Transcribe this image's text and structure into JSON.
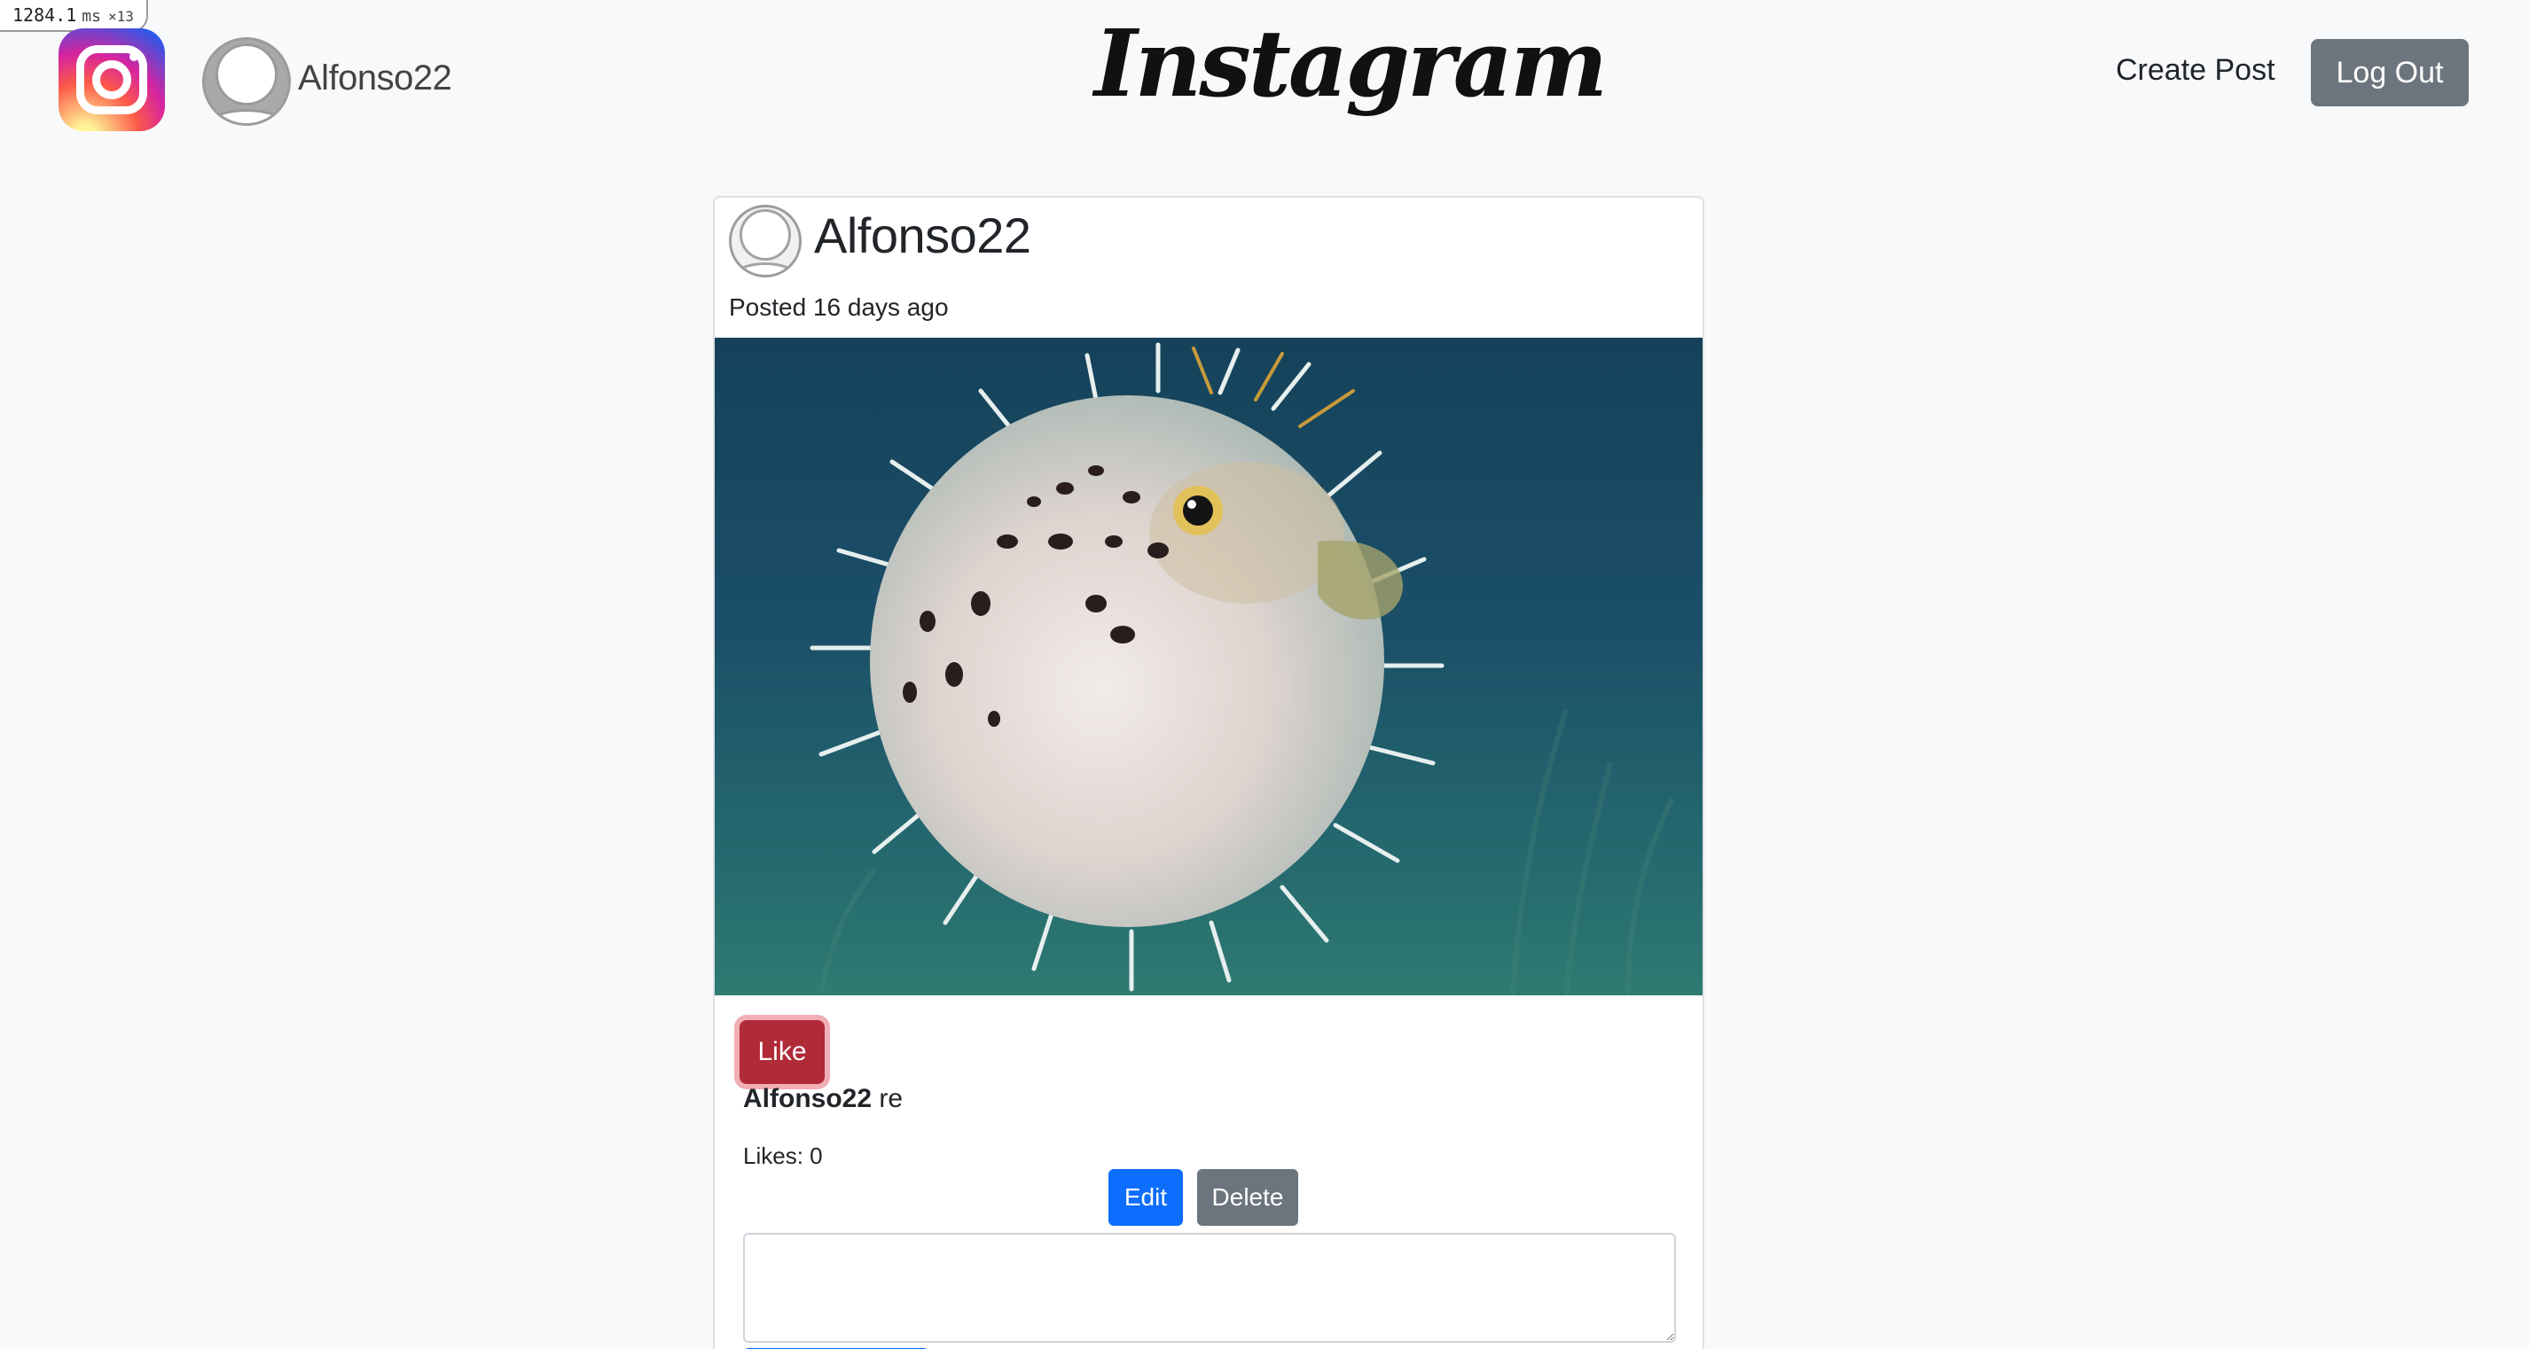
{
  "perf": {
    "value": "1284.1",
    "unit": "ms",
    "multiplier": "×13"
  },
  "header": {
    "username": "Alfonso22",
    "brand": "Instagram",
    "create_post": "Create Post",
    "logout": "Log Out"
  },
  "post": {
    "author": "Alfonso22",
    "posted": "Posted 16 days ago",
    "like": "Like",
    "caption_author": "Alfonso22",
    "caption_text": "re",
    "likes_label": "Likes: 0",
    "edit": "Edit",
    "delete": "Delete",
    "comment_value": "",
    "colors": {
      "like": "#b02a37",
      "edit": "#0d6efd",
      "secondary": "#6c757d"
    }
  }
}
